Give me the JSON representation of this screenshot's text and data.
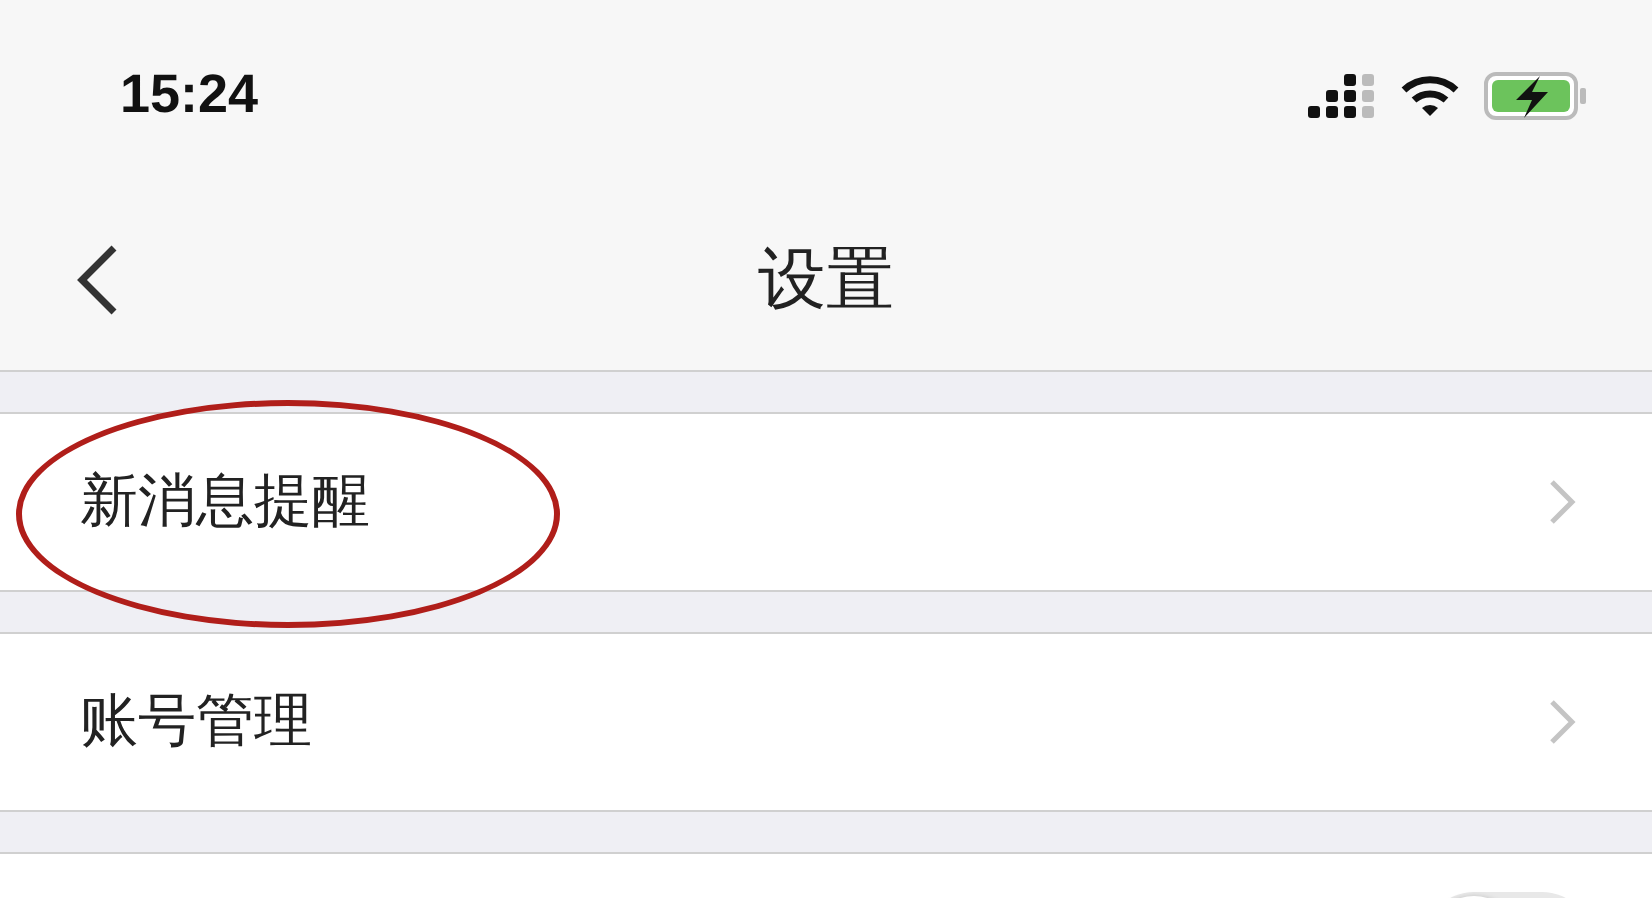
{
  "status_bar": {
    "time": "15:24"
  },
  "nav": {
    "title": "设置"
  },
  "rows": [
    {
      "kind": "link",
      "label": "新消息提醒",
      "highlighted": true
    },
    {
      "kind": "link",
      "label": "账号管理",
      "highlighted": false
    },
    {
      "kind": "toggle",
      "on": false,
      "highlighted": false
    }
  ]
}
